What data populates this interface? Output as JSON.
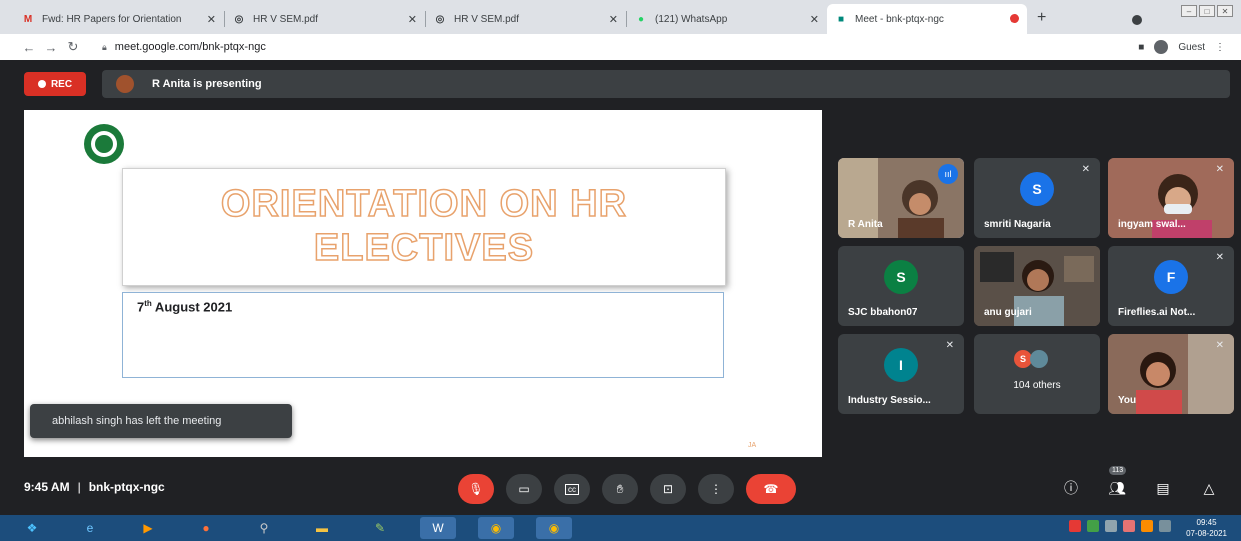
{
  "browser": {
    "tabs": [
      {
        "title": "Fwd: HR Papers for Orientation",
        "icon": "gmail-icon",
        "active": false
      },
      {
        "title": "HR V SEM.pdf",
        "icon": "globe-icon",
        "active": false
      },
      {
        "title": "HR V SEM.pdf",
        "icon": "globe-icon",
        "active": false
      },
      {
        "title": "(121) WhatsApp",
        "icon": "whatsapp-icon",
        "active": false
      },
      {
        "title": "Meet - bnk-ptqx-ngc",
        "icon": "meet-icon",
        "active": true
      }
    ],
    "new_tab": "+",
    "url": "meet.google.com/bnk-ptqx-ngc",
    "profile": "Guest",
    "colors": {
      "tabbar": "#dee1e6",
      "recording": "#e53935"
    }
  },
  "meet": {
    "rec_label": "REC",
    "presenting_text": "R Anita is presenting",
    "slide": {
      "title_line1": "ORIENTATION ON HR",
      "title_line2": "ELECTIVES",
      "date_day": "7",
      "date_suffix": "th",
      "date_rest": " August 2021",
      "footer_mark": "JA"
    },
    "toast": "abhilash singh has left the meeting",
    "participants": [
      {
        "name": "R Anita",
        "type": "video",
        "active": true,
        "speaking": true
      },
      {
        "name": "smriti Nagaria",
        "type": "avatar",
        "letter": "S",
        "color": "#1a73e8",
        "muted": true
      },
      {
        "name": "ingyam swal...",
        "type": "video",
        "muted": true
      },
      {
        "name": "SJC bbahon07",
        "type": "avatar",
        "letter": "S",
        "color": "#0b8043",
        "muted": false
      },
      {
        "name": "anu gujari",
        "type": "video",
        "muted": false
      },
      {
        "name": "Fireflies.ai Not...",
        "type": "avatar",
        "letter": "F",
        "color": "#1a73e8",
        "muted": true
      },
      {
        "name": "Industry Sessio...",
        "type": "avatar",
        "letter": "I",
        "color": "#00838f",
        "muted": true
      },
      {
        "name": "104 others",
        "type": "others",
        "letter": "S"
      },
      {
        "name": "You",
        "type": "video",
        "muted": true
      }
    ],
    "bottom": {
      "time": "9:45 AM",
      "separator": "|",
      "meeting_code": "bnk-ptqx-ngc",
      "people_count": "113"
    }
  },
  "taskbar": {
    "clock_time": "09:45",
    "clock_date": "07-08-2021"
  }
}
